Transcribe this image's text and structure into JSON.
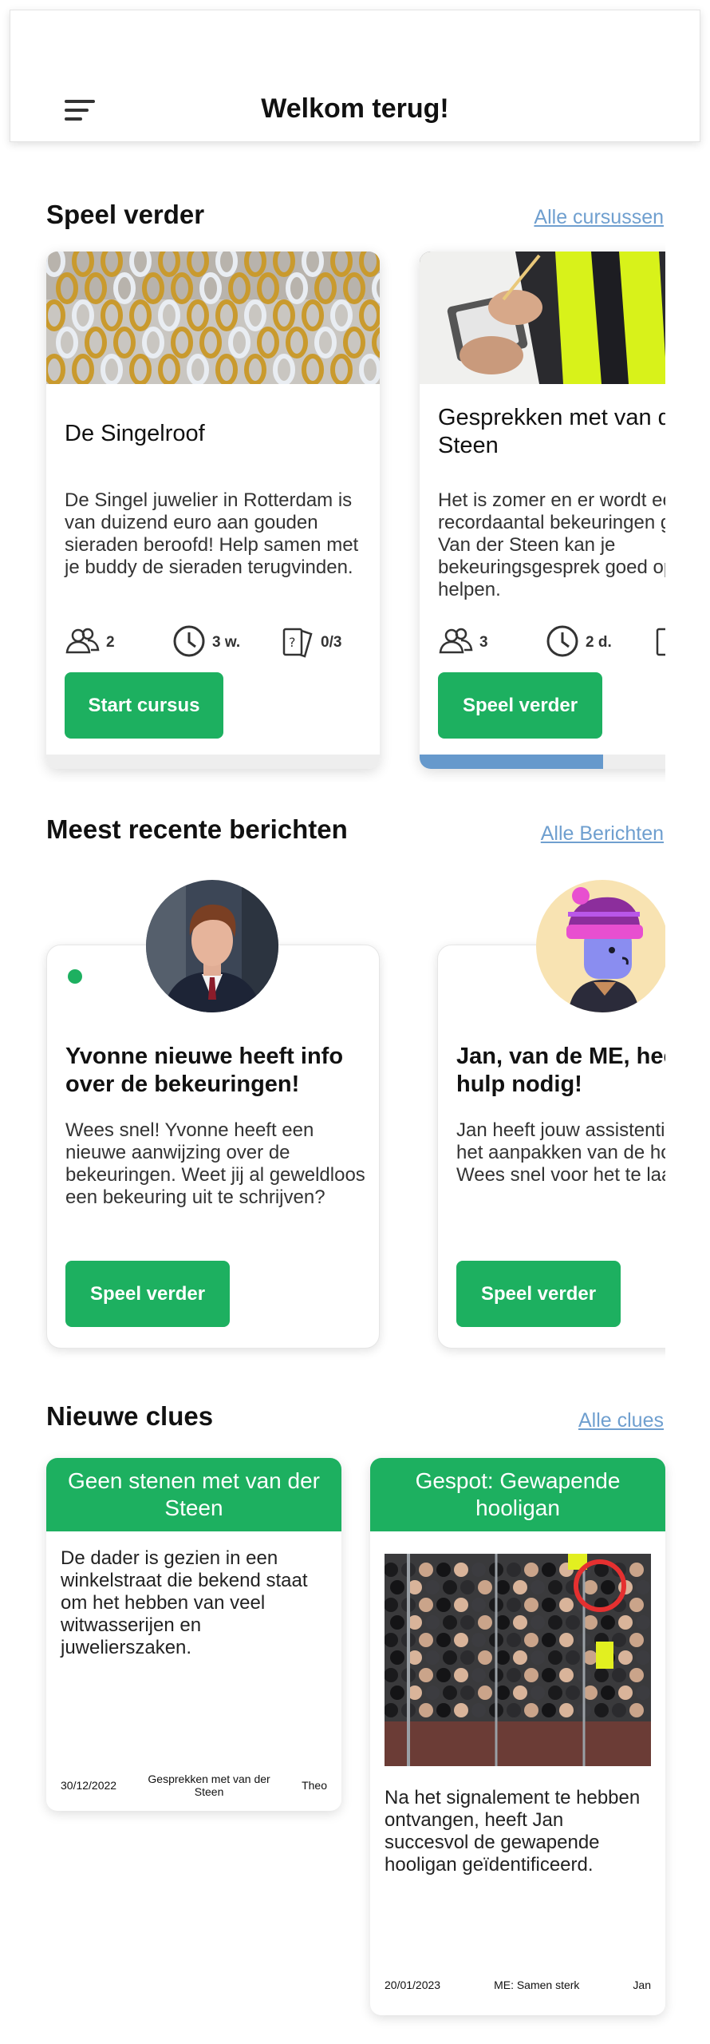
{
  "header": {
    "title": "Welkom terug!",
    "menu_icon": "menu-icon"
  },
  "courses": {
    "title": "Speel verder",
    "link": "Alle cursussen",
    "cards": [
      {
        "title": "De Singelroof",
        "text": "De Singel juwelier in Rotterdam is van duizend euro aan gouden sieraden beroofd! Help samen met je buddy de sieraden terugvinden.",
        "players": "2",
        "time": "3 w.",
        "cards_count": "0/3",
        "button": "Start cursus",
        "progress": 0
      },
      {
        "title": "Gesprekken met van der Steen",
        "text": "Het is zomer en er wordt een recordaantal bekeuringen gegeven. Van der Steen kan je bekeuringsgesprek goed op gang helpen.",
        "players": "3",
        "time": "2 d.",
        "cards_count": "",
        "button": "Speel verder",
        "progress": 0.55
      }
    ]
  },
  "messages": {
    "title": "Meest recente berichten",
    "link": "Alle Berichten",
    "items": [
      {
        "title": "Yvonne nieuwe heeft info over de bekeuringen!",
        "text": "Wees snel! Yvonne heeft een nieuwe aanwijzing over de bekeuringen. Weet jij al geweldloos een bekeuring uit te schrijven?",
        "button": "Speel verder",
        "unread": true
      },
      {
        "title": "Jan, van de ME, heeft jouw hulp nodig!",
        "text": "Jan heeft jouw assistentie nodig in het aanpakken van de hooligans! Wees snel voor het te laat is.",
        "button": "Speel verder",
        "unread": false
      }
    ]
  },
  "clues": {
    "title": "Nieuwe clues",
    "link": "Alle clues",
    "items": [
      {
        "title": "Geen stenen met van der Steen",
        "text": "De dader is gezien in een winkelstraat die bekend staat om het hebben van veel witwasserijen en juwelierszaken.",
        "date": "30/12/2022",
        "course": "Gesprekken met van der Steen",
        "author": "Theo"
      },
      {
        "title": "Gespot: Gewapende hooligan",
        "text": "Na het signalement te hebben ontvangen, heeft Jan succesvol de gewapende hooligan geïdentificeerd.",
        "date": "20/01/2023",
        "course": "ME: Samen sterk",
        "author": "Jan"
      }
    ]
  },
  "colors": {
    "accent": "#1db060",
    "link": "#6f9fcf",
    "progress": "#6699cc"
  }
}
